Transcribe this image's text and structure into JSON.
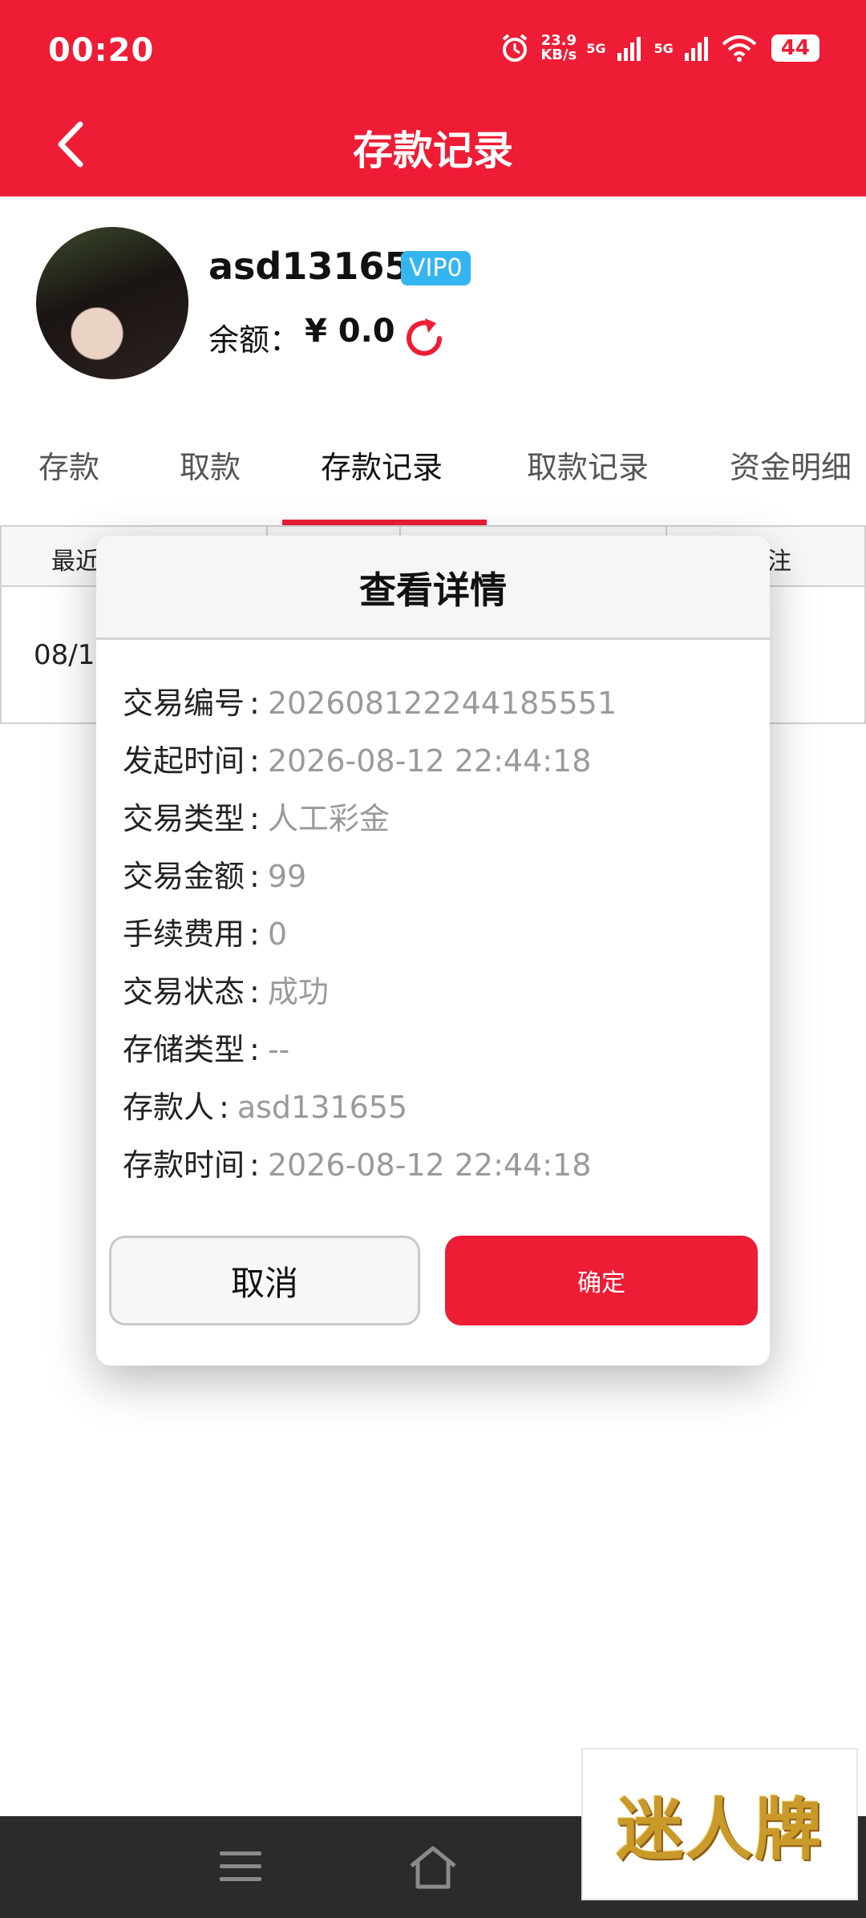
{
  "status_bar": {
    "time": "00:20",
    "speed_value": "23.9",
    "speed_unit": "KB/s",
    "net1": "5G",
    "net2": "5G",
    "battery": "44"
  },
  "header": {
    "title": "存款记录"
  },
  "profile": {
    "username": "asd131655",
    "vip": "VIP0",
    "balance_label": "余额：",
    "balance_value": "¥ 0.0"
  },
  "tabs": [
    {
      "label": "存款"
    },
    {
      "label": "取款"
    },
    {
      "label": "存款记录"
    },
    {
      "label": "取款记录"
    },
    {
      "label": "资金明细"
    }
  ],
  "table": {
    "header_first": "最近",
    "header_last": "注",
    "row_first": "08/1"
  },
  "modal": {
    "title": "查看详情",
    "rows": [
      {
        "label": "交易编号",
        "value": "202608122244185551"
      },
      {
        "label": "发起时间",
        "value": "2026-08-12 22:44:18"
      },
      {
        "label": "交易类型",
        "value": "人工彩金"
      },
      {
        "label": "交易金额",
        "value": "99"
      },
      {
        "label": "手续费用",
        "value": "0"
      },
      {
        "label": "交易状态",
        "value": "成功"
      },
      {
        "label": "存储类型",
        "value": "--"
      },
      {
        "label": "存款人",
        "value": "asd131655"
      },
      {
        "label": "存款时间",
        "value": "2026-08-12 22:44:18"
      }
    ],
    "separator": ":",
    "cancel_label": "取消",
    "confirm_label": "确定"
  },
  "brand": {
    "text": "迷人牌"
  },
  "colors": {
    "accent": "#ee1c35",
    "vip": "#35b5ef",
    "muted_value": "#9a9a9a"
  },
  "icons": {
    "back": "chevron-left-icon",
    "refresh": "refresh-icon",
    "menu": "menu-icon",
    "home": "home-icon"
  }
}
